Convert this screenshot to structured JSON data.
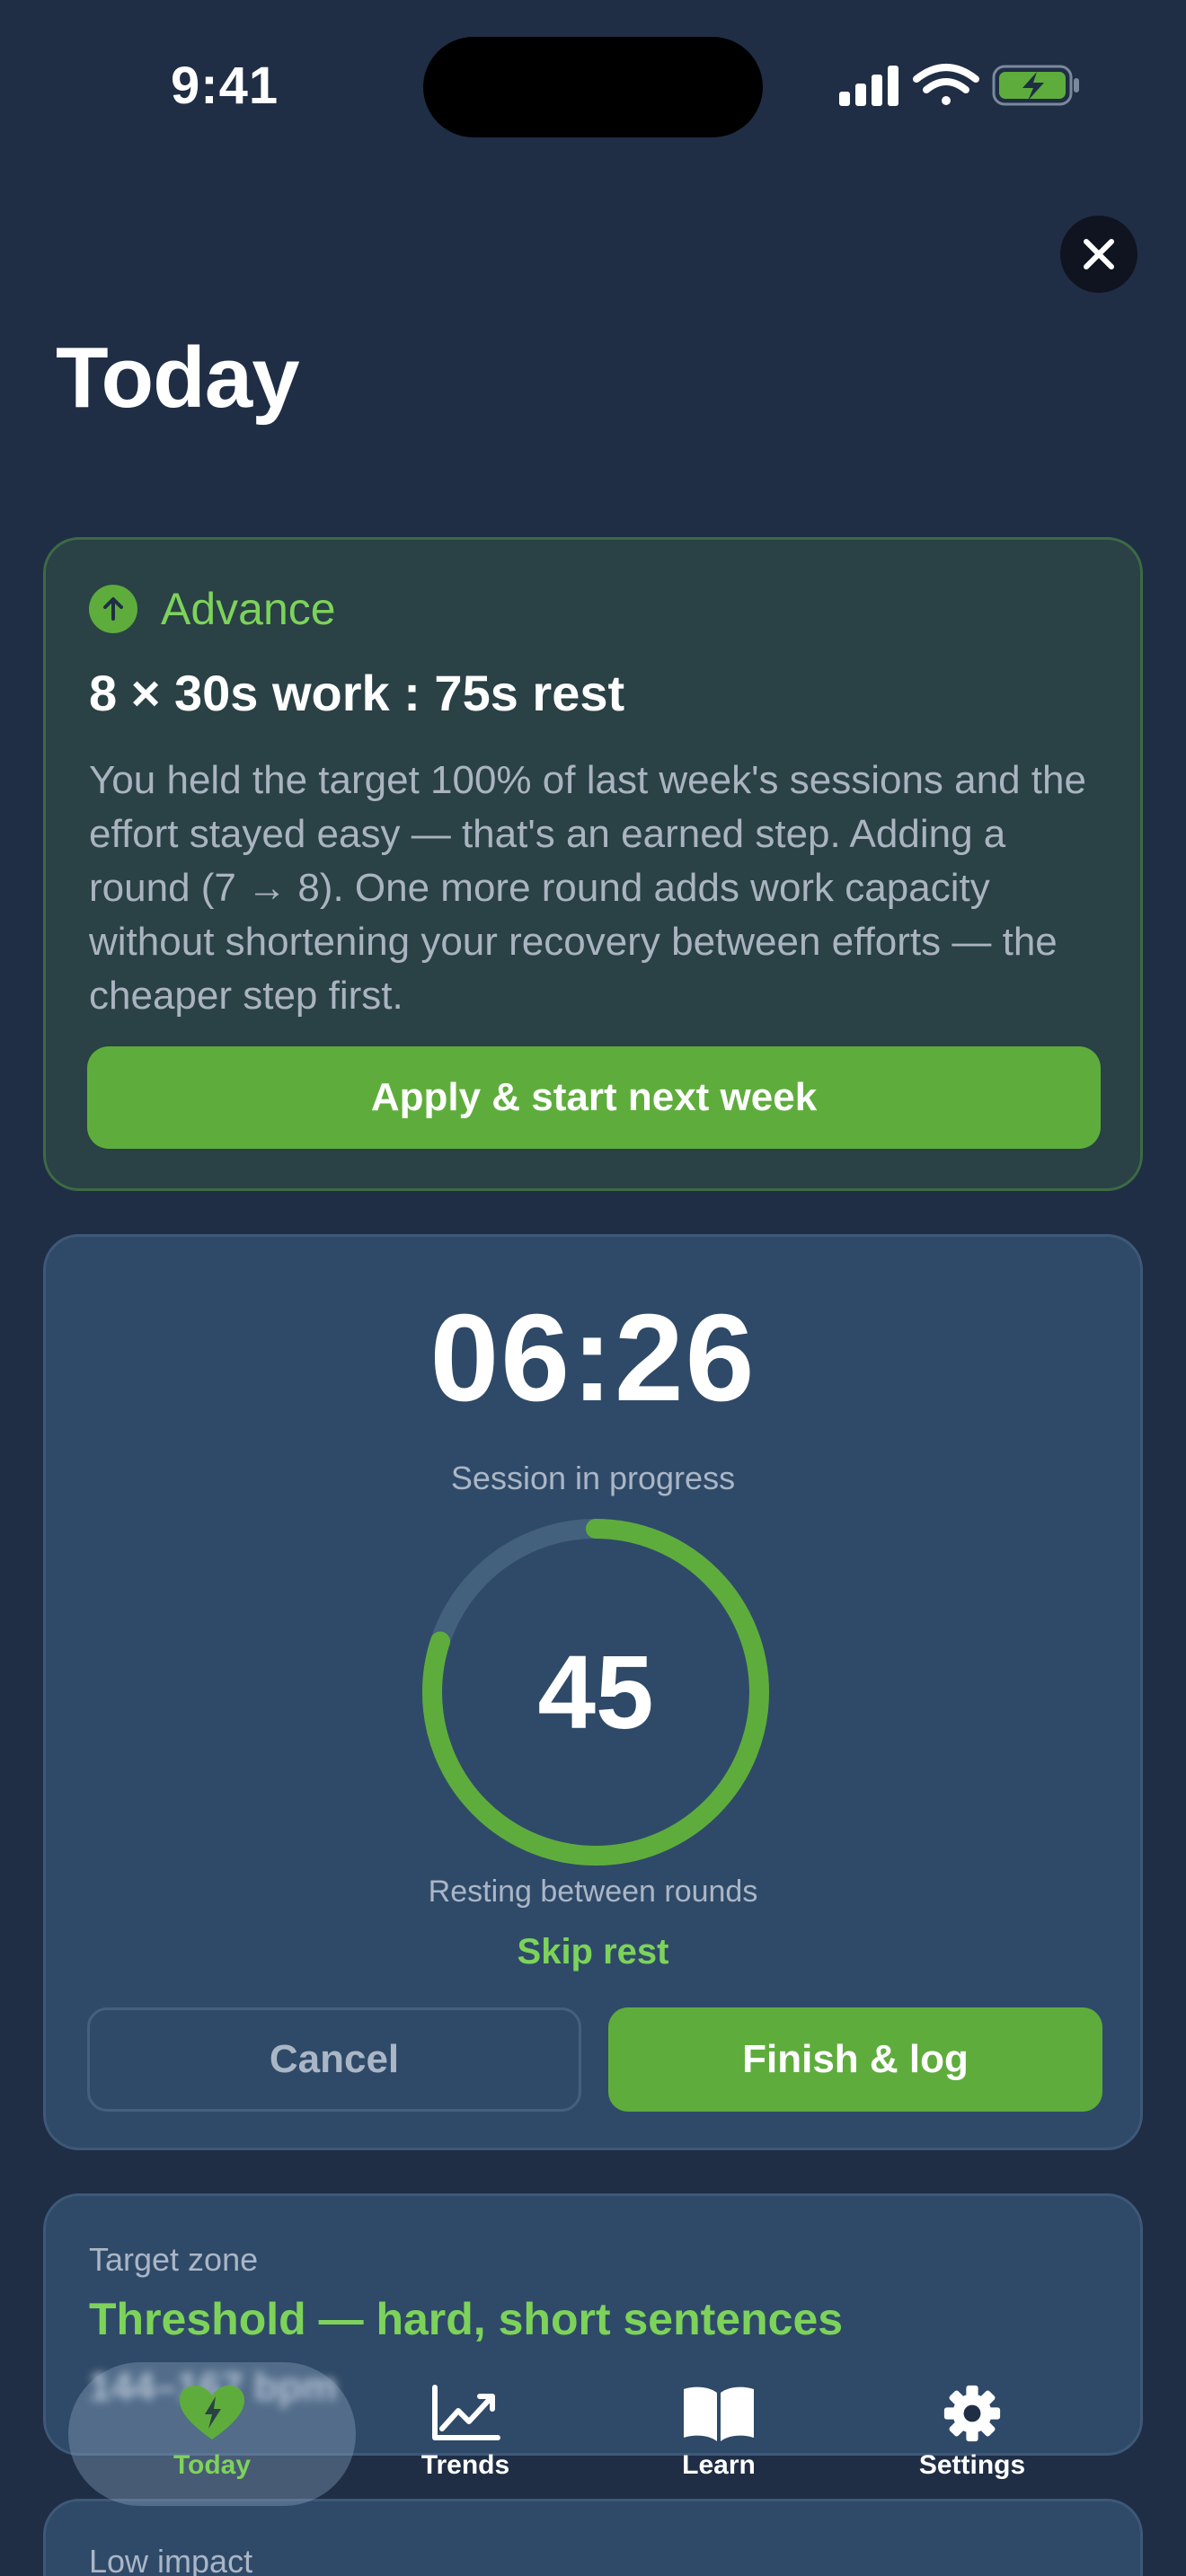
{
  "status_bar": {
    "time": "9:41",
    "icons": [
      "cellular-signal-icon",
      "wifi-icon",
      "battery-charging-icon"
    ]
  },
  "header": {
    "close_icon": "close-icon",
    "title": "Today"
  },
  "advance_card": {
    "icon": "arrow-up-circle-icon",
    "label": "Advance",
    "title": "8 × 30s work : 75s rest",
    "body": "You held the target 100% of last week's sessions and the effort stayed easy — that's an earned step. Adding a round (7 → 8). One more round adds work capacity without shortening your recovery between efforts — the cheaper step first.",
    "apply_label": "Apply & start next week"
  },
  "session_card": {
    "timer": "06:26",
    "status": "Session in progress",
    "rest_seconds": "45",
    "rest_progress": 0.8,
    "rest_label": "Resting between rounds",
    "skip_label": "Skip rest",
    "cancel_label": "Cancel",
    "finish_label": "Finish & log"
  },
  "zone_card": {
    "label": "Target zone",
    "title": "Threshold — hard, short sentences",
    "bpm": "144–167 bpm"
  },
  "impact_card": {
    "label": "Low impact"
  },
  "tab_bar": {
    "tabs": [
      {
        "label": "Today",
        "icon": "heart-bolt-icon",
        "active": true
      },
      {
        "label": "Trends",
        "icon": "trend-chart-icon",
        "active": false
      },
      {
        "label": "Learn",
        "icon": "book-icon",
        "active": false
      },
      {
        "label": "Settings",
        "icon": "gear-icon",
        "active": false
      }
    ]
  },
  "colors": {
    "background": "#1f2e45",
    "accent_green": "#5ead3c",
    "accent_green_text": "#7dd35a",
    "card": "#2f4a68",
    "advance_card": "#2a4146"
  }
}
